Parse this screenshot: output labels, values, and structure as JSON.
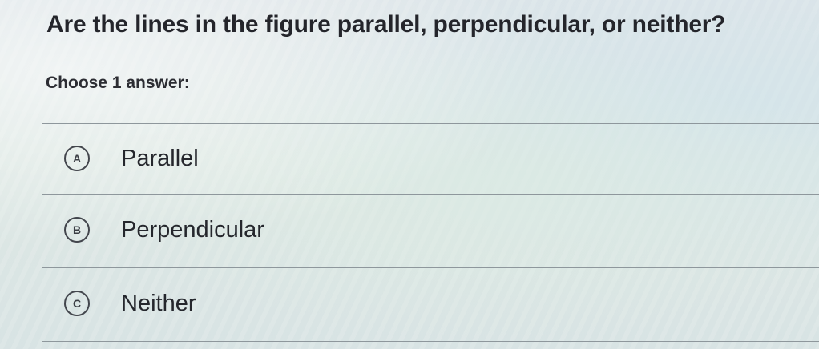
{
  "question": {
    "text": "Are the lines in the figure parallel, perpendicular, or neither?"
  },
  "instruction": "Choose 1 answer:",
  "choices": [
    {
      "letter": "A",
      "label": "Parallel"
    },
    {
      "letter": "B",
      "label": "Perpendicular"
    },
    {
      "letter": "C",
      "label": "Neither"
    }
  ]
}
